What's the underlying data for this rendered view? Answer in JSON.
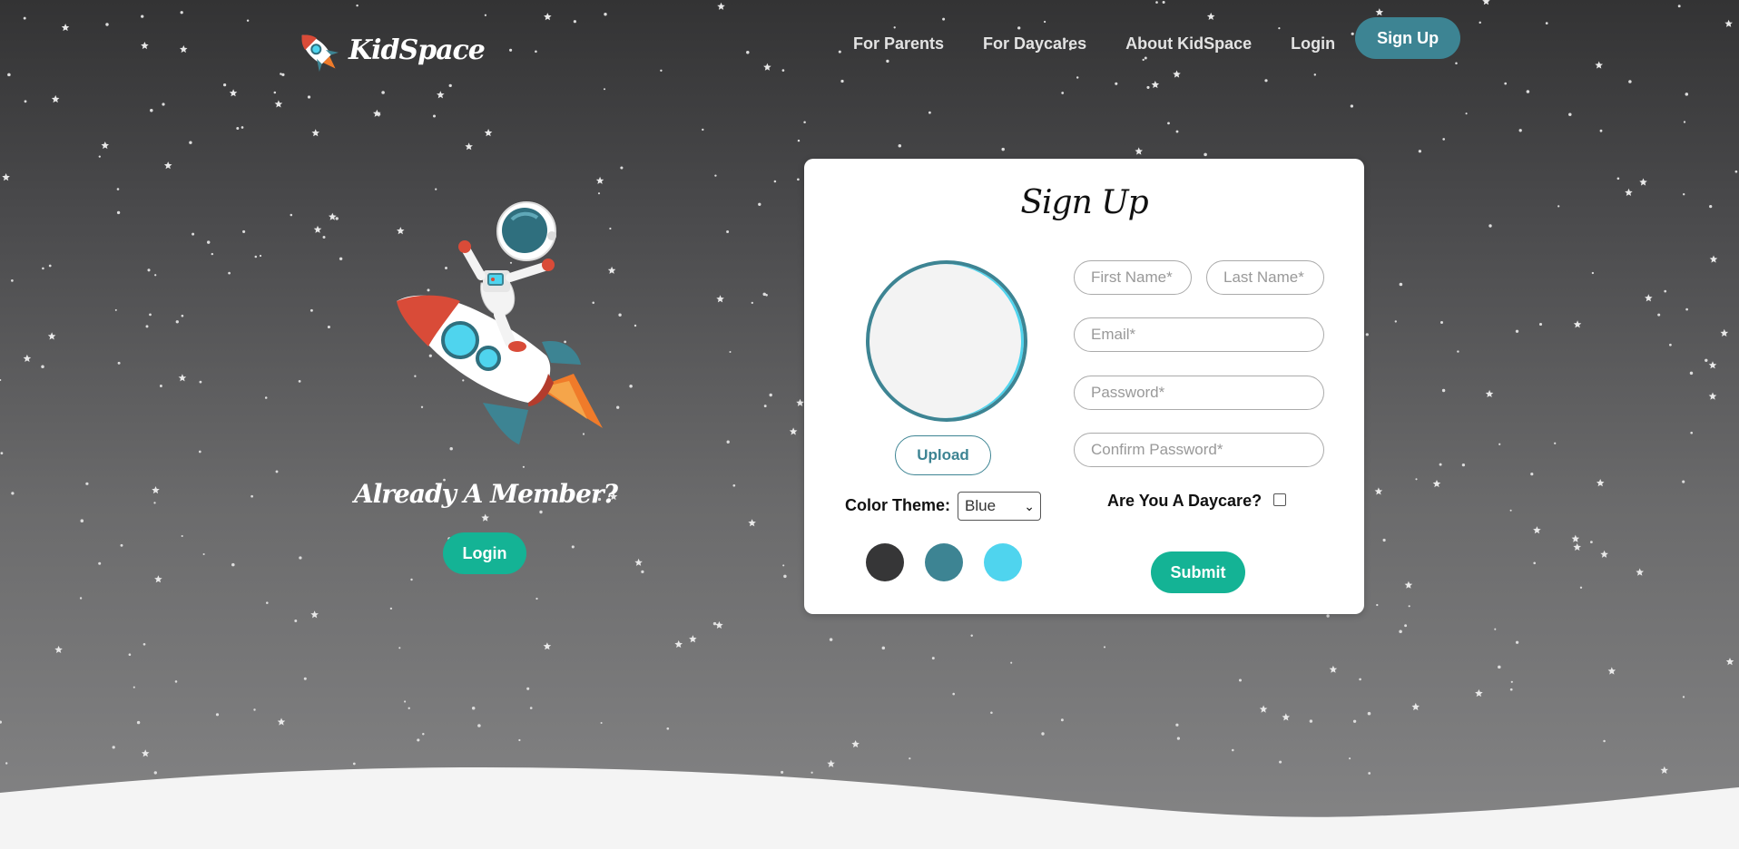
{
  "brand": {
    "name": "KidSpace"
  },
  "nav": {
    "links": [
      "For Parents",
      "For Daycares",
      "About KidSpace",
      "Login"
    ],
    "signup": "Sign Up"
  },
  "left": {
    "heading": "Already A Member?",
    "login": "Login"
  },
  "form": {
    "title": "Sign Up",
    "upload": "Upload",
    "color_theme_label": "Color Theme:",
    "color_theme_value": "Blue",
    "swatches": [
      "#363637",
      "#3d8493",
      "#4fd4ee"
    ],
    "first_name_placeholder": "First Name*",
    "last_name_placeholder": "Last Name*",
    "email_placeholder": "Email*",
    "password_placeholder": "Password*",
    "confirm_password_placeholder": "Confirm Password*",
    "daycare_label": "Are You A Daycare?",
    "daycare_checked": false,
    "submit": "Submit"
  },
  "colors": {
    "accent_green": "#14b395",
    "accent_blue": "#3d8493",
    "light_blue": "#4fd4ee",
    "bg_top": "#333334",
    "bg_bottom": "#858586"
  },
  "icons": [
    "rocket-icon",
    "astronaut-rocket-illustration",
    "select-chevron-icon"
  ]
}
